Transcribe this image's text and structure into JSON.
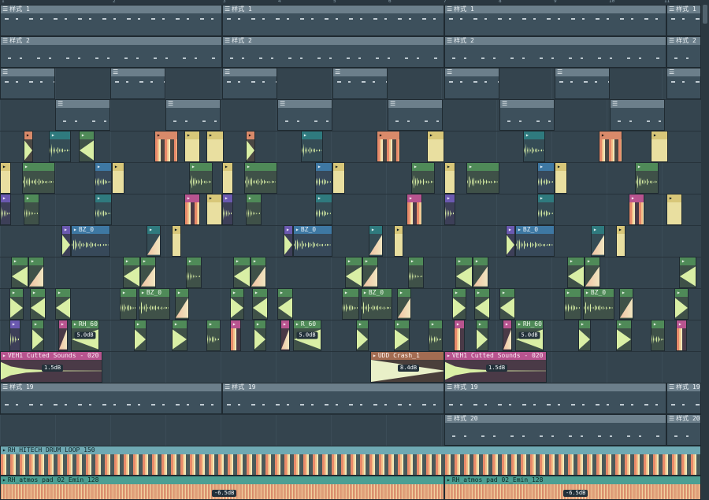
{
  "ruler": {
    "ticks": [
      "1",
      "2",
      "3",
      "4",
      "5",
      "6",
      "7",
      "8",
      "9",
      "10",
      "11",
      "12",
      "13"
    ]
  },
  "labels": {
    "pattern1": "样式 1",
    "pattern2": "样式 2",
    "pattern19": "样式 19",
    "pattern20": "样式 20",
    "bz": "BZ_0",
    "rh60": "RH_60",
    "r60": "R_60",
    "veh": "VEH1 Cutted Sounds - 020",
    "crash": "UDD Crash_1",
    "loop": "RH_HITECH DRUM LOOP_150",
    "pad": "RH_atmos pad 02_Emin_128"
  },
  "gains": {
    "g50": "5.0dB",
    "g15": "1.5dB",
    "g84": "8.4dB",
    "g65": "-6.5dB"
  },
  "icons": {
    "pattern": "pattern-icon",
    "audio": "audio-clip-icon"
  },
  "colors": {
    "background": "#34444e",
    "pattern_header": "#6c7f8b",
    "audio_yellow": "#e9dfa0",
    "waveform": "#d9efa5",
    "veh_header": "#b8548f",
    "crash_header": "#a36c52",
    "loop_header": "#6fa9b3",
    "pad_header": "#4c9f93"
  }
}
